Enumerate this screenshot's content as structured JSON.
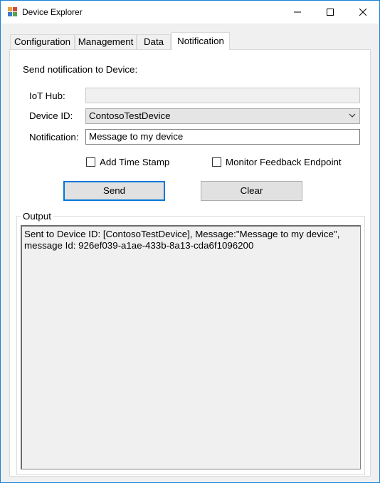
{
  "window": {
    "title": "Device Explorer"
  },
  "tabs": [
    {
      "label": "Configuration"
    },
    {
      "label": "Management"
    },
    {
      "label": "Data"
    },
    {
      "label": "Notification"
    }
  ],
  "notification": {
    "heading": "Send notification to Device:",
    "iot_hub_label": "IoT Hub:",
    "iot_hub_value": "",
    "device_id_label": "Device ID:",
    "device_id_value": "ContosoTestDevice",
    "notification_label": "Notification:",
    "notification_value": "Message to my device",
    "add_time_stamp_label": "Add Time Stamp",
    "monitor_feedback_label": "Monitor Feedback Endpoint",
    "send_label": "Send",
    "clear_label": "Clear"
  },
  "output": {
    "title": "Output",
    "text": "Sent to Device ID: [ContosoTestDevice], Message:\"Message to my device\",\nmessage Id: 926ef039-a1ae-433b-8a13-cda6f1096200"
  }
}
